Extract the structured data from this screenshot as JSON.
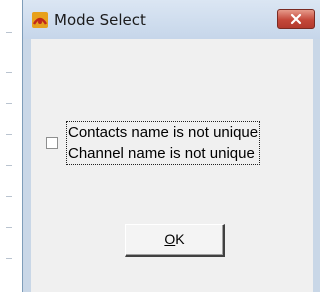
{
  "window": {
    "title": "Mode Select",
    "icon": "app-icon"
  },
  "controls": {
    "close_icon": "close-icon"
  },
  "checkbox": {
    "checked": false,
    "lines": [
      "Contacts name is not unique",
      "Channel name is not unique"
    ]
  },
  "ok_button": {
    "mnemonic": "O",
    "rest": "K"
  },
  "colors": {
    "titlebar": "#c9d7e7",
    "close_button": "#c4483a",
    "client": "#f0f0f0"
  }
}
